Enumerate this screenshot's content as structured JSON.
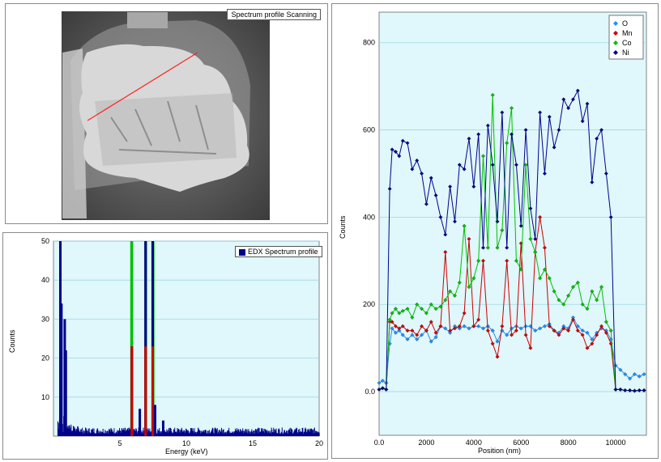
{
  "image_panel": {
    "title": "Spectrum profile Scanning"
  },
  "chart_data": [
    {
      "type": "bar",
      "legend": [
        "EDX Spectrum profile"
      ],
      "xlabel": "Energy (keV)",
      "ylabel": "Counts",
      "xlim": [
        0,
        20
      ],
      "ylim": [
        0,
        50
      ],
      "xticks": [
        "5",
        "10",
        "15",
        "20"
      ],
      "yticks": [
        "10",
        "20",
        "30",
        "40",
        "50"
      ],
      "grid": true,
      "peaks_keV": [
        {
          "x": 0.52,
          "y": 60
        },
        {
          "x": 0.6,
          "y": 34
        },
        {
          "x": 0.85,
          "y": 30
        },
        {
          "x": 0.93,
          "y": 22
        },
        {
          "x": 5.9,
          "y": 23
        },
        {
          "x": 6.5,
          "y": 7
        },
        {
          "x": 6.93,
          "y": 60
        },
        {
          "x": 7.47,
          "y": 60
        },
        {
          "x": 7.65,
          "y": 8
        },
        {
          "x": 8.26,
          "y": 4
        }
      ],
      "highlight_bands": [
        {
          "x": [
            5.78,
            6.0
          ],
          "color": "#00c000"
        },
        {
          "x": [
            6.85,
            7.05
          ],
          "color": "#00c000"
        },
        {
          "x": [
            7.37,
            7.6
          ],
          "color": "#00c000"
        },
        {
          "x": [
            0.45,
            0.6
          ],
          "color": "#00c000"
        }
      ],
      "colors": {
        "plot_bg": "#e0f7fb",
        "bars": "#00008b",
        "element_lines": "#cc0000"
      }
    },
    {
      "type": "line",
      "xlabel": "Position (nm)",
      "ylabel": "Counts",
      "xlim": [
        0,
        11300
      ],
      "ylim": [
        -100,
        870
      ],
      "xticks": [
        "0.0",
        "2000",
        "4000",
        "6000",
        "8000",
        "10000"
      ],
      "yticks": [
        "0.0",
        "200",
        "400",
        "600",
        "800"
      ],
      "grid": true,
      "legend_position": "top-right",
      "series": [
        {
          "name": "O",
          "color": "#1e90ff",
          "points": [
            [
              0,
              20
            ],
            [
              150,
              25
            ],
            [
              300,
              20
            ],
            [
              450,
              110
            ],
            [
              550,
              145
            ],
            [
              700,
              135
            ],
            [
              850,
              140
            ],
            [
              1000,
              130
            ],
            [
              1200,
              120
            ],
            [
              1400,
              130
            ],
            [
              1600,
              120
            ],
            [
              1800,
              130
            ],
            [
              2000,
              140
            ],
            [
              2200,
              115
            ],
            [
              2400,
              125
            ],
            [
              2600,
              150
            ],
            [
              2800,
              145
            ],
            [
              3000,
              135
            ],
            [
              3200,
              150
            ],
            [
              3400,
              145
            ],
            [
              3600,
              150
            ],
            [
              3800,
              145
            ],
            [
              4000,
              150
            ],
            [
              4200,
              150
            ],
            [
              4400,
              145
            ],
            [
              4600,
              150
            ],
            [
              4800,
              140
            ],
            [
              5000,
              115
            ],
            [
              5200,
              140
            ],
            [
              5400,
              130
            ],
            [
              5600,
              145
            ],
            [
              5800,
              150
            ],
            [
              6000,
              145
            ],
            [
              6200,
              150
            ],
            [
              6400,
              150
            ],
            [
              6600,
              140
            ],
            [
              6800,
              145
            ],
            [
              7000,
              150
            ],
            [
              7200,
              155
            ],
            [
              7400,
              140
            ],
            [
              7600,
              135
            ],
            [
              7800,
              150
            ],
            [
              8000,
              145
            ],
            [
              8200,
              170
            ],
            [
              8400,
              150
            ],
            [
              8600,
              140
            ],
            [
              8800,
              135
            ],
            [
              9000,
              120
            ],
            [
              9200,
              135
            ],
            [
              9400,
              145
            ],
            [
              9600,
              140
            ],
            [
              9800,
              120
            ],
            [
              10000,
              60
            ],
            [
              10200,
              50
            ],
            [
              10400,
              40
            ],
            [
              10600,
              30
            ],
            [
              10800,
              40
            ],
            [
              11000,
              35
            ],
            [
              11200,
              40
            ]
          ]
        },
        {
          "name": "Mn",
          "color": "#cc0000",
          "points": [
            [
              0,
              5
            ],
            [
              150,
              8
            ],
            [
              300,
              5
            ],
            [
              450,
              160
            ],
            [
              550,
              160
            ],
            [
              700,
              150
            ],
            [
              850,
              145
            ],
            [
              1000,
              150
            ],
            [
              1200,
              140
            ],
            [
              1400,
              140
            ],
            [
              1600,
              130
            ],
            [
              1800,
              150
            ],
            [
              2000,
              140
            ],
            [
              2200,
              160
            ],
            [
              2400,
              135
            ],
            [
              2600,
              150
            ],
            [
              2800,
              320
            ],
            [
              3000,
              140
            ],
            [
              3200,
              145
            ],
            [
              3400,
              150
            ],
            [
              3600,
              180
            ],
            [
              3800,
              350
            ],
            [
              4000,
              150
            ],
            [
              4200,
              165
            ],
            [
              4400,
              300
            ],
            [
              4600,
              140
            ],
            [
              4800,
              110
            ],
            [
              5000,
              80
            ],
            [
              5200,
              150
            ],
            [
              5400,
              300
            ],
            [
              5600,
              130
            ],
            [
              5800,
              140
            ],
            [
              6000,
              340
            ],
            [
              6200,
              130
            ],
            [
              6400,
              100
            ],
            [
              6600,
              320
            ],
            [
              6800,
              400
            ],
            [
              7000,
              330
            ],
            [
              7200,
              150
            ],
            [
              7400,
              140
            ],
            [
              7600,
              130
            ],
            [
              7800,
              145
            ],
            [
              8000,
              140
            ],
            [
              8200,
              165
            ],
            [
              8400,
              140
            ],
            [
              8600,
              130
            ],
            [
              8800,
              100
            ],
            [
              9000,
              110
            ],
            [
              9200,
              130
            ],
            [
              9400,
              150
            ],
            [
              9600,
              135
            ],
            [
              9800,
              110
            ],
            [
              10000,
              5
            ],
            [
              10200,
              5
            ],
            [
              10400,
              3
            ],
            [
              10600,
              3
            ],
            [
              10800,
              2
            ],
            [
              11000,
              3
            ],
            [
              11200,
              3
            ]
          ]
        },
        {
          "name": "Co",
          "color": "#00c000",
          "points": [
            [
              0,
              5
            ],
            [
              150,
              8
            ],
            [
              300,
              5
            ],
            [
              450,
              165
            ],
            [
              550,
              180
            ],
            [
              700,
              190
            ],
            [
              850,
              180
            ],
            [
              1000,
              185
            ],
            [
              1200,
              190
            ],
            [
              1400,
              170
            ],
            [
              1600,
              200
            ],
            [
              1800,
              190
            ],
            [
              2000,
              180
            ],
            [
              2200,
              200
            ],
            [
              2400,
              190
            ],
            [
              2600,
              195
            ],
            [
              2800,
              210
            ],
            [
              3000,
              230
            ],
            [
              3200,
              220
            ],
            [
              3400,
              250
            ],
            [
              3600,
              380
            ],
            [
              3800,
              240
            ],
            [
              4000,
              260
            ],
            [
              4200,
              300
            ],
            [
              4400,
              540
            ],
            [
              4600,
              330
            ],
            [
              4800,
              680
            ],
            [
              5000,
              330
            ],
            [
              5200,
              370
            ],
            [
              5400,
              570
            ],
            [
              5600,
              650
            ],
            [
              5800,
              300
            ],
            [
              6000,
              280
            ],
            [
              6200,
              520
            ],
            [
              6400,
              350
            ],
            [
              6600,
              320
            ],
            [
              6800,
              260
            ],
            [
              7000,
              280
            ],
            [
              7200,
              260
            ],
            [
              7400,
              230
            ],
            [
              7600,
              210
            ],
            [
              7800,
              200
            ],
            [
              8000,
              220
            ],
            [
              8200,
              240
            ],
            [
              8400,
              250
            ],
            [
              8600,
              200
            ],
            [
              8800,
              190
            ],
            [
              9000,
              230
            ],
            [
              9200,
              210
            ],
            [
              9400,
              240
            ],
            [
              9600,
              160
            ],
            [
              9800,
              140
            ],
            [
              10000,
              5
            ],
            [
              10200,
              5
            ],
            [
              10400,
              3
            ],
            [
              10600,
              3
            ],
            [
              10800,
              2
            ],
            [
              11000,
              3
            ],
            [
              11200,
              3
            ]
          ]
        },
        {
          "name": "Ni",
          "color": "#00008b",
          "points": [
            [
              0,
              5
            ],
            [
              150,
              8
            ],
            [
              300,
              5
            ],
            [
              450,
              465
            ],
            [
              550,
              555
            ],
            [
              700,
              550
            ],
            [
              850,
              540
            ],
            [
              1000,
              575
            ],
            [
              1200,
              570
            ],
            [
              1400,
              510
            ],
            [
              1600,
              530
            ],
            [
              1800,
              500
            ],
            [
              2000,
              430
            ],
            [
              2200,
              490
            ],
            [
              2400,
              450
            ],
            [
              2600,
              400
            ],
            [
              2800,
              360
            ],
            [
              3000,
              470
            ],
            [
              3200,
              390
            ],
            [
              3400,
              520
            ],
            [
              3600,
              510
            ],
            [
              3800,
              580
            ],
            [
              4000,
              470
            ],
            [
              4200,
              590
            ],
            [
              4400,
              330
            ],
            [
              4600,
              610
            ],
            [
              4800,
              520
            ],
            [
              5000,
              390
            ],
            [
              5200,
              640
            ],
            [
              5400,
              330
            ],
            [
              5600,
              590
            ],
            [
              5800,
              520
            ],
            [
              6000,
              380
            ],
            [
              6200,
              600
            ],
            [
              6400,
              420
            ],
            [
              6600,
              350
            ],
            [
              6800,
              640
            ],
            [
              7000,
              500
            ],
            [
              7200,
              630
            ],
            [
              7400,
              560
            ],
            [
              7600,
              600
            ],
            [
              7800,
              670
            ],
            [
              8000,
              650
            ],
            [
              8200,
              670
            ],
            [
              8400,
              690
            ],
            [
              8600,
              620
            ],
            [
              8800,
              660
            ],
            [
              9000,
              480
            ],
            [
              9200,
              580
            ],
            [
              9400,
              600
            ],
            [
              9600,
              500
            ],
            [
              9800,
              400
            ],
            [
              10000,
              5
            ],
            [
              10200,
              5
            ],
            [
              10400,
              3
            ],
            [
              10600,
              3
            ],
            [
              10800,
              2
            ],
            [
              11000,
              3
            ],
            [
              11200,
              3
            ]
          ]
        }
      ],
      "colors": {
        "plot_bg": "#e0f7fb"
      }
    }
  ]
}
